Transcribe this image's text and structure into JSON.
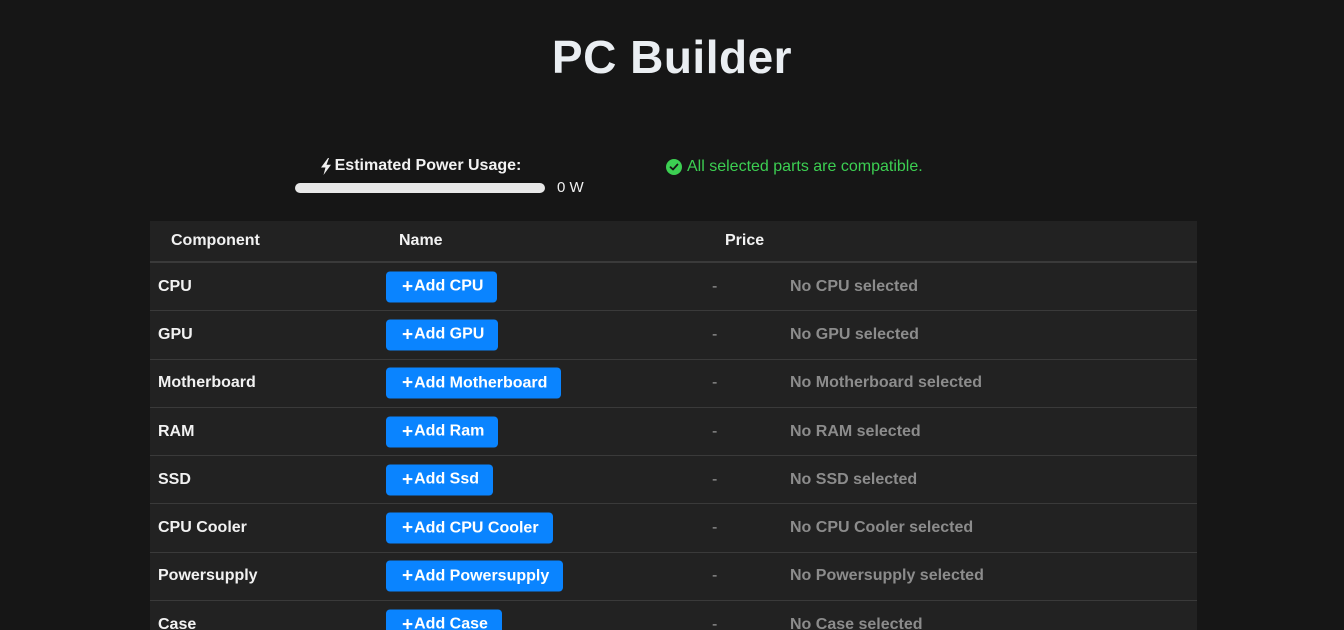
{
  "title": "PC Builder",
  "power": {
    "label": "Estimated Power Usage:",
    "value": "0 W",
    "fraction": 0
  },
  "compatibility": {
    "text": "All selected parts are compatible.",
    "color": "#3ccf52"
  },
  "table": {
    "headers": {
      "component": "Component",
      "name": "Name",
      "price": "Price"
    },
    "rows": [
      {
        "component": "CPU",
        "button": "Add CPU",
        "price": "-",
        "status": "No CPU selected"
      },
      {
        "component": "GPU",
        "button": "Add GPU",
        "price": "-",
        "status": "No GPU selected"
      },
      {
        "component": "Motherboard",
        "button": "Add Motherboard",
        "price": "-",
        "status": "No Motherboard selected"
      },
      {
        "component": "RAM",
        "button": "Add Ram",
        "price": "-",
        "status": "No RAM selected"
      },
      {
        "component": "SSD",
        "button": "Add Ssd",
        "price": "-",
        "status": "No SSD selected"
      },
      {
        "component": "CPU Cooler",
        "button": "Add CPU Cooler",
        "price": "-",
        "status": "No CPU Cooler selected"
      },
      {
        "component": "Powersupply",
        "button": "Add Powersupply",
        "price": "-",
        "status": "No Powersupply selected"
      },
      {
        "component": "Case",
        "button": "Add Case",
        "price": "-",
        "status": "No Case selected"
      }
    ]
  },
  "colors": {
    "accent": "#0a84ff",
    "background": "#161616",
    "table_bg": "#222222"
  }
}
